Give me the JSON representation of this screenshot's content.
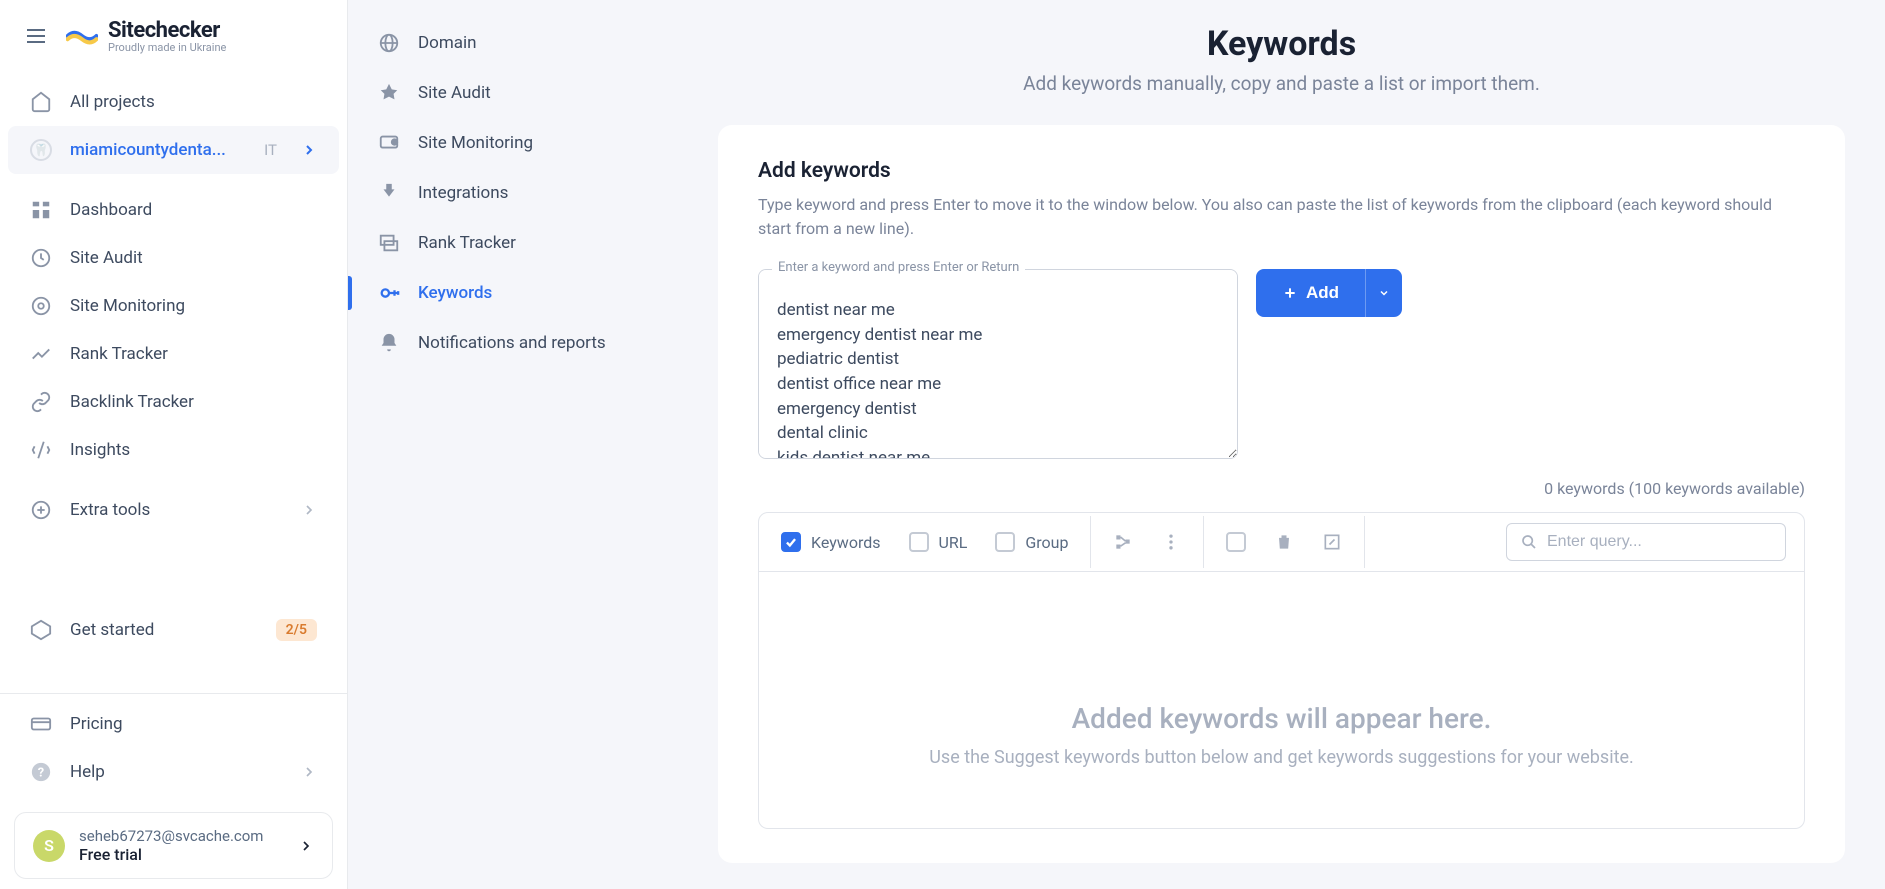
{
  "brand": {
    "name": "Sitechecker",
    "tagline": "Proudly made in Ukraine"
  },
  "nav_left": [
    {
      "key": "all-projects",
      "label": "All projects"
    },
    {
      "key": "project",
      "label": "miamicountydenta...",
      "tag": "IT"
    },
    {
      "key": "dashboard",
      "label": "Dashboard"
    },
    {
      "key": "site-audit",
      "label": "Site Audit"
    },
    {
      "key": "site-monitoring",
      "label": "Site Monitoring"
    },
    {
      "key": "rank-tracker",
      "label": "Rank Tracker"
    },
    {
      "key": "backlink-tracker",
      "label": "Backlink Tracker"
    },
    {
      "key": "insights",
      "label": "Insights"
    },
    {
      "key": "extra-tools",
      "label": "Extra tools"
    },
    {
      "key": "get-started",
      "label": "Get started",
      "badge": "2/5"
    },
    {
      "key": "pricing",
      "label": "Pricing"
    },
    {
      "key": "help",
      "label": "Help"
    }
  ],
  "nav_second": [
    {
      "key": "domain",
      "label": "Domain"
    },
    {
      "key": "site-audit",
      "label": "Site Audit"
    },
    {
      "key": "site-monitoring",
      "label": "Site Monitoring"
    },
    {
      "key": "integrations",
      "label": "Integrations"
    },
    {
      "key": "rank-tracker",
      "label": "Rank Tracker"
    },
    {
      "key": "keywords",
      "label": "Keywords",
      "active": true
    },
    {
      "key": "notifications",
      "label": "Notifications and reports"
    }
  ],
  "page": {
    "title": "Keywords",
    "subtitle": "Add keywords manually, copy and paste a list or import them."
  },
  "add_section": {
    "title": "Add keywords",
    "description": "Type keyword and press Enter to move it to the window below. You also can paste the list of keywords from the clipboard (each keyword should start from a new line).",
    "textarea_label": "Enter a keyword and press Enter or Return",
    "textarea_value": "dentist near me\nemergency dentist near me\npediatric dentist\ndentist office near me\nemergency dentist\ndental clinic\nkids dentist near me",
    "add_button": "Add",
    "counter": "0 keywords (100 keywords available)"
  },
  "toolbar": {
    "keywords_label": "Keywords",
    "url_label": "URL",
    "group_label": "Group",
    "search_placeholder": "Enter query..."
  },
  "empty": {
    "title": "Added keywords will appear here.",
    "subtitle": "Use the Suggest keywords button below and get keywords suggestions for your website."
  },
  "user": {
    "initial": "S",
    "email": "seheb67273@svcache.com",
    "plan": "Free trial"
  }
}
